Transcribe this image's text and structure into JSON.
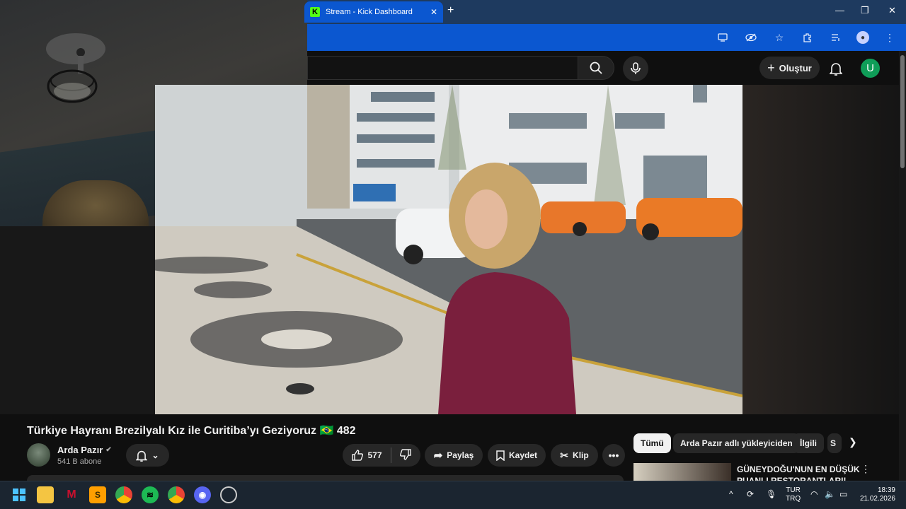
{
  "browser": {
    "tab_title": "Stream - Kick Dashboard",
    "tab_icon": "kick-logo-icon",
    "tab_close": "✕",
    "new_tab": "+",
    "window_controls": [
      "—",
      "❐",
      "✕"
    ]
  },
  "youtube": {
    "create_label": "Oluştur",
    "avatar_letter": "U"
  },
  "video": {
    "title": "Türkiye Hayranı Brezilyalı Kız ile Curitiba’yı Geziyoruz 🇧🇷 482",
    "channel_name": "Arda Pazır",
    "channel_subs": "541 B abone",
    "likes": "577",
    "share_label": "Paylaş",
    "save_label": "Kaydet",
    "clip_label": "Klip"
  },
  "chips": {
    "all": "Tümü",
    "uploader": "Arda Pazır adlı yükleyiciden",
    "related": "İlgili",
    "cut": "S"
  },
  "recommendation": {
    "title": "GÜNEYDOĞU'NUN EN DÜŞÜK PUANLI RESTORANTLARI!"
  },
  "taskbar": {
    "lang_top": "TUR",
    "lang_bottom": "TRQ",
    "time": "18:39",
    "date": "21.02.2026"
  },
  "colors": {
    "kick_green": "#53fc18",
    "chrome_blue": "#0b57d0",
    "yt_dark": "#0f0f0f",
    "avatar_green": "#0f9d58"
  }
}
